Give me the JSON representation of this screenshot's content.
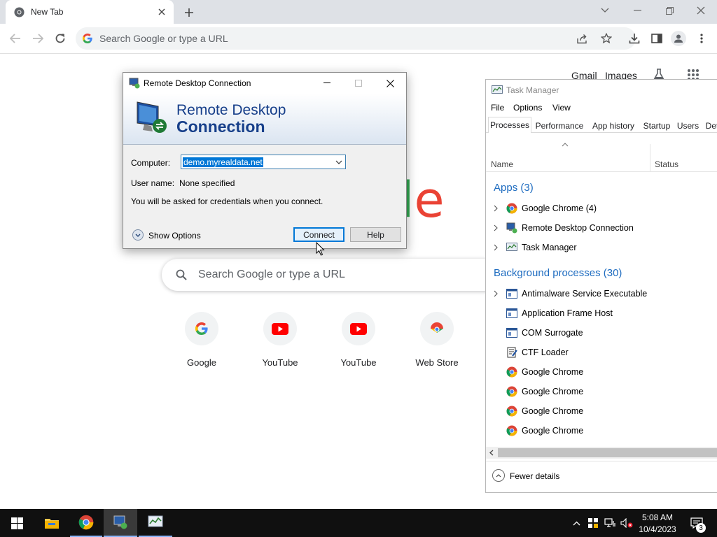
{
  "browser": {
    "tab_title": "New Tab",
    "omnibox_placeholder": "Search Google or type a URL"
  },
  "ntp": {
    "links": {
      "gmail": "Gmail",
      "images": "Images"
    },
    "logo_partial": "le",
    "search_placeholder": "Search Google or type a URL",
    "shortcuts": [
      {
        "label": "Google",
        "icon": "google-g-icon"
      },
      {
        "label": "YouTube",
        "icon": "youtube-icon"
      },
      {
        "label": "YouTube",
        "icon": "youtube-icon"
      },
      {
        "label": "Web Store",
        "icon": "web-store-icon"
      }
    ]
  },
  "rdc": {
    "title": "Remote Desktop Connection",
    "banner_line1": "Remote Desktop",
    "banner_line2": "Connection",
    "computer_label": "Computer:",
    "computer_value": "demo.myrealdata.net",
    "username_label": "User name:",
    "username_value": "None specified",
    "note": "You will be asked for credentials when you connect.",
    "show_options": "Show Options",
    "connect": "Connect",
    "help": "Help"
  },
  "task_manager": {
    "title": "Task Manager",
    "menu": [
      "File",
      "Options",
      "View"
    ],
    "tabs": [
      "Processes",
      "Performance",
      "App history",
      "Startup",
      "Users",
      "Det"
    ],
    "active_tab": "Processes",
    "columns": {
      "name": "Name",
      "status": "Status"
    },
    "apps_header": "Apps (3)",
    "apps": [
      {
        "name": "Google Chrome (4)",
        "icon": "chrome-icon",
        "expandable": true
      },
      {
        "name": "Remote Desktop Connection",
        "icon": "rdc-icon",
        "expandable": true
      },
      {
        "name": "Task Manager",
        "icon": "task-manager-icon",
        "expandable": true
      }
    ],
    "bg_header": "Background processes (30)",
    "background": [
      {
        "name": "Antimalware Service Executable",
        "icon": "service-icon",
        "expandable": true
      },
      {
        "name": "Application Frame Host",
        "icon": "service-icon",
        "expandable": false
      },
      {
        "name": "COM Surrogate",
        "icon": "service-icon",
        "expandable": false
      },
      {
        "name": "CTF Loader",
        "icon": "ctf-icon",
        "expandable": false
      },
      {
        "name": "Google Chrome",
        "icon": "chrome-icon",
        "expandable": false
      },
      {
        "name": "Google Chrome",
        "icon": "chrome-icon",
        "expandable": false
      },
      {
        "name": "Google Chrome",
        "icon": "chrome-icon",
        "expandable": false
      },
      {
        "name": "Google Chrome",
        "icon": "chrome-icon",
        "expandable": false
      }
    ],
    "fewer_details": "Fewer details"
  },
  "taskbar": {
    "time": "5:08 AM",
    "date": "10/4/2023",
    "notification_count": "3"
  }
}
